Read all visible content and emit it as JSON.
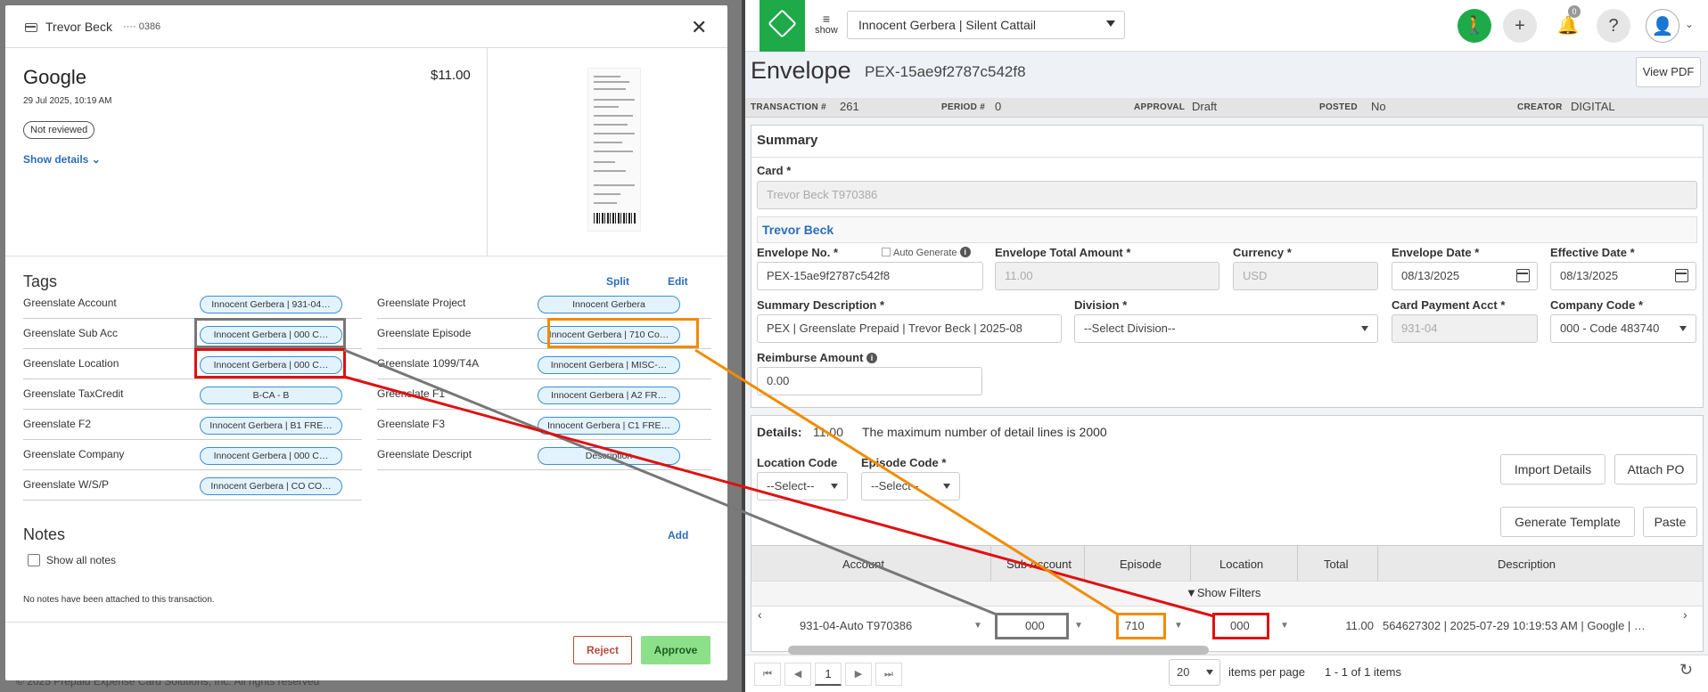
{
  "modal": {
    "cardholder": "Trevor Beck",
    "card_last4": "···· 0386",
    "merchant": "Google",
    "datetime": "29 Jul 2025, 10:19 AM",
    "amount": "$11.00",
    "review_status": "Not reviewed",
    "show_details": "Show details",
    "tags_title": "Tags",
    "split": "Split",
    "edit": "Edit",
    "tags_left": [
      {
        "label": "Greenslate Account",
        "value": "Innocent Gerbera | 931-04…"
      },
      {
        "label": "Greenslate Sub Acc",
        "value": "Innocent Gerbera | 000 C…"
      },
      {
        "label": "Greenslate Location",
        "value": "Innocent Gerbera | 000 C…"
      },
      {
        "label": "Greenslate TaxCredit",
        "value": "B-CA - B"
      },
      {
        "label": "Greenslate F2",
        "value": "Innocent Gerbera | B1 FRE…"
      },
      {
        "label": "Greenslate Company",
        "value": "Innocent Gerbera | 000 C…"
      },
      {
        "label": "Greenslate W/S/P",
        "value": "Innocent Gerbera | CO CO…"
      }
    ],
    "tags_right": [
      {
        "label": "Greenslate Project",
        "value": "Innocent Gerbera"
      },
      {
        "label": "Greenslate Episode",
        "value": "Innocent Gerbera | 710 Co…"
      },
      {
        "label": "Greenslate 1099/T4A",
        "value": "Innocent Gerbera | MISC-…"
      },
      {
        "label": "Greenslate F1",
        "value": "Innocent Gerbera | A2 FR…"
      },
      {
        "label": "Greenslate F3",
        "value": "Innocent Gerbera | C1 FRE…"
      },
      {
        "label": "Greenslate Descript",
        "value": "Description"
      }
    ],
    "notes_title": "Notes",
    "notes_add": "Add",
    "show_all_notes": "Show all notes",
    "no_notes": "No notes have been attached to this transaction.",
    "reject": "Reject",
    "approve": "Approve"
  },
  "background_footer": "© 2025 Prepaid Expense Card Solutions, Inc. All rights reserved",
  "topbar": {
    "show": "show",
    "workspace": "Innocent Gerbera | Silent Cattail",
    "notifications_count": "0",
    "help": "?"
  },
  "envelope": {
    "title": "Envelope",
    "id": "PEX-15ae9f2787c542f8",
    "view_pdf": "View PDF",
    "info": [
      {
        "label": "TRANSACTION #",
        "value": "261"
      },
      {
        "label": "PERIOD #",
        "value": "0"
      },
      {
        "label": "APPROVAL",
        "value": "Draft"
      },
      {
        "label": "POSTED",
        "value": "No"
      },
      {
        "label": "CREATOR",
        "value": "DIGITAL"
      }
    ]
  },
  "summary": {
    "title": "Summary",
    "card_label": "Card",
    "card_value": "Trevor Beck T970386",
    "cardholder": "Trevor Beck",
    "env_no_label": "Envelope No.",
    "auto_generate": "Auto Generate",
    "env_no_value": "PEX-15ae9f2787c542f8",
    "total_label": "Envelope Total Amount",
    "total_value": "11.00",
    "currency_label": "Currency",
    "currency_value": "USD",
    "env_date_label": "Envelope Date",
    "env_date_value": "08/13/2025",
    "eff_date_label": "Effective Date",
    "eff_date_value": "08/13/2025",
    "desc_label": "Summary Description",
    "desc_value": "PEX | Greenslate Prepaid | Trevor Beck | 2025-08",
    "division_label": "Division",
    "division_value": "--Select Division--",
    "payacct_label": "Card Payment Acct",
    "payacct_value": "931-04",
    "company_label": "Company Code",
    "company_value": "000 - Code 483740",
    "reimb_label": "Reimburse Amount",
    "reimb_value": "0.00",
    "required": "*"
  },
  "details": {
    "label": "Details:",
    "amount": "11.00",
    "max_note": "The maximum number of detail lines is 2000",
    "loc_code_label": "Location Code",
    "loc_code_value": "--Select--",
    "ep_code_label": "Episode Code",
    "ep_code_value": "--Select--",
    "import": "Import Details",
    "attach": "Attach PO",
    "generate": "Generate Template",
    "paste": "Paste",
    "columns": [
      "Account",
      "Sub Account",
      "Episode",
      "Location",
      "Total",
      "Description"
    ],
    "show_filters": "Show Filters",
    "row": {
      "account": "931-04-Auto T970386",
      "sub_account": "000",
      "episode": "710",
      "location": "000",
      "total": "11.00",
      "description": "564627302 | 2025-07-29 10:19:53 AM | Google | …"
    }
  },
  "pager": {
    "page": "1",
    "page_size": "20",
    "per_page": "items per page",
    "range": "1 - 1 of 1 items"
  },
  "colors": {
    "gray_box": "#777777",
    "red_box": "#e01010",
    "orange_box": "#f08c00",
    "brand_green": "#1faa4a"
  }
}
